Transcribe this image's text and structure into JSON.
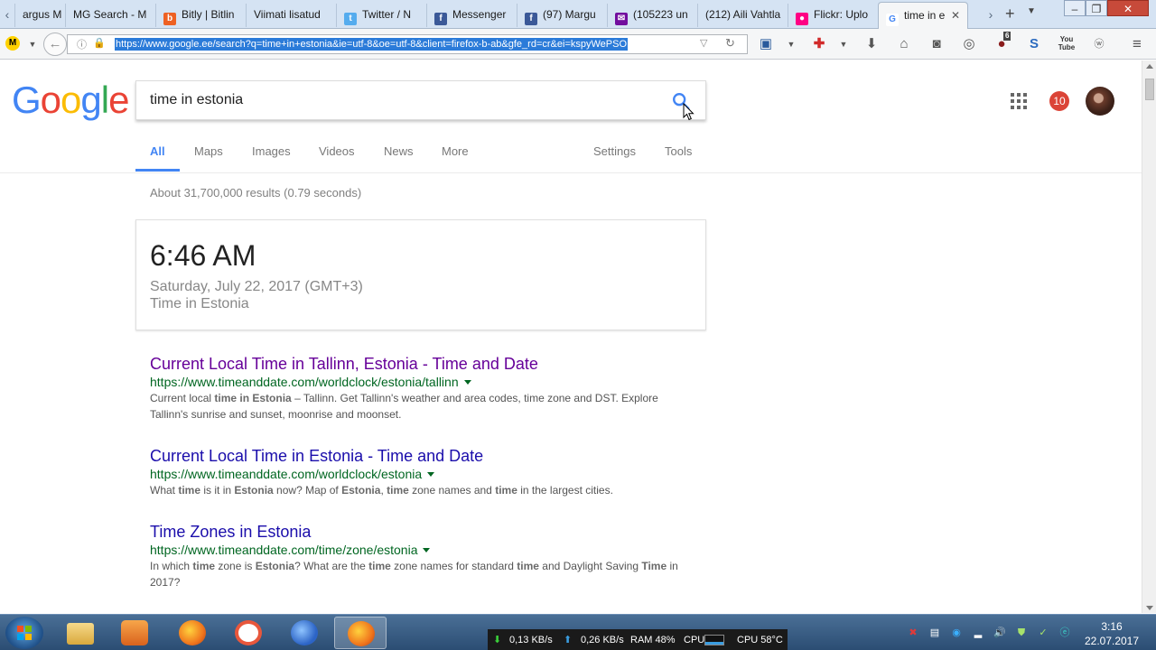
{
  "browser": {
    "tabs": [
      {
        "label": "argus M",
        "icon": "page-icon"
      },
      {
        "label": "MG Search - M",
        "icon": "page-icon"
      },
      {
        "label": "Bitly | Bitlin",
        "icon": "bitly-icon"
      },
      {
        "label": "Viimati lisatud",
        "icon": "page-icon"
      },
      {
        "label": "Twitter / N",
        "icon": "twitter-icon"
      },
      {
        "label": "Messenger",
        "icon": "facebook-icon"
      },
      {
        "label": "(97) Margu",
        "icon": "facebook-icon"
      },
      {
        "label": "(105223 un",
        "icon": "mail-icon"
      },
      {
        "label": "(212) Aili Vahtla",
        "icon": "page-icon"
      },
      {
        "label": "Flickr: Uplo",
        "icon": "flickr-icon"
      },
      {
        "label": "time in e",
        "icon": "google-icon",
        "active": true
      }
    ],
    "new_tab_label": "+",
    "url": "https://www.google.ee/search?q=time+in+estonia&ie=utf-8&oe=utf-8&client=firefox-b-ab&gfe_rd=cr&ei=kspyWePSO",
    "toolbar_icons": [
      "save-icon",
      "first-aid-icon",
      "download-icon",
      "home-icon",
      "pocket-icon",
      "sync-icon",
      "ublock-icon",
      "s-icon",
      "youtube-icon",
      "w-icon",
      "menu-icon"
    ],
    "ublock_badge": "6"
  },
  "google": {
    "logo": [
      "G",
      "o",
      "o",
      "g",
      "l",
      "e"
    ],
    "logo_colors": [
      "#4285f4",
      "#ea4335",
      "#fbbc05",
      "#4285f4",
      "#34a853",
      "#ea4335"
    ],
    "query": "time in estonia",
    "notifications": "10",
    "nav": {
      "all": "All",
      "maps": "Maps",
      "images": "Images",
      "videos": "Videos",
      "news": "News",
      "more": "More",
      "settings": "Settings",
      "tools": "Tools"
    },
    "stats": "About 31,700,000 results (0.79 seconds)",
    "time_card": {
      "time": "6:46 AM",
      "date": "Saturday, July 22, 2017 (GMT+3)",
      "label": "Time in Estonia"
    },
    "results": [
      {
        "title": "Current Local Time in Tallinn, Estonia - Time and Date",
        "url": "https://www.timeanddate.com/worldclock/estonia/tallinn",
        "visited": true,
        "snippet": [
          {
            "t": "Current local ",
            "b": false
          },
          {
            "t": "time in Estonia",
            "b": true
          },
          {
            "t": " – Tallinn. Get Tallinn's weather and area codes, time zone and DST. Explore Tallinn's sunrise and sunset, moonrise and moonset.",
            "b": false
          }
        ]
      },
      {
        "title": "Current Local Time in Estonia - Time and Date",
        "url": "https://www.timeanddate.com/worldclock/estonia",
        "visited": false,
        "snippet": [
          {
            "t": "What ",
            "b": false
          },
          {
            "t": "time",
            "b": true
          },
          {
            "t": " is it in ",
            "b": false
          },
          {
            "t": "Estonia",
            "b": true
          },
          {
            "t": " now? Map of ",
            "b": false
          },
          {
            "t": "Estonia",
            "b": true
          },
          {
            "t": ", ",
            "b": false
          },
          {
            "t": "time",
            "b": true
          },
          {
            "t": " zone names and ",
            "b": false
          },
          {
            "t": "time",
            "b": true
          },
          {
            "t": " in the largest cities.",
            "b": false
          }
        ]
      },
      {
        "title": "Time Zones in Estonia",
        "url": "https://www.timeanddate.com/time/zone/estonia",
        "visited": false,
        "snippet": [
          {
            "t": "In which ",
            "b": false
          },
          {
            "t": "time",
            "b": true
          },
          {
            "t": " zone is ",
            "b": false
          },
          {
            "t": "Estonia",
            "b": true
          },
          {
            "t": "? What are the ",
            "b": false
          },
          {
            "t": "time",
            "b": true
          },
          {
            "t": " zone names for standard ",
            "b": false
          },
          {
            "t": "time",
            "b": true
          },
          {
            "t": " and Daylight Saving ",
            "b": false
          },
          {
            "t": "Time",
            "b": true
          },
          {
            "t": " in 2017?",
            "b": false
          }
        ]
      }
    ]
  },
  "taskbar": {
    "apps": [
      "explorer-icon",
      "media-player-icon",
      "firefox-icon",
      "app-circle-icon",
      "thunderbird-icon",
      "firefox-active-icon"
    ],
    "net_down": "0,13 KB/s",
    "net_up": "0,26 KB/s",
    "ram": "RAM 48%",
    "cpu_label": "CPU",
    "cpu_temp": "CPU 58°C",
    "clock_time": "3:16",
    "clock_date": "22.07.2017"
  },
  "colors": {
    "link": "#1a0dab",
    "visited": "#660099",
    "url_green": "#006621",
    "accent": "#4285f4"
  }
}
